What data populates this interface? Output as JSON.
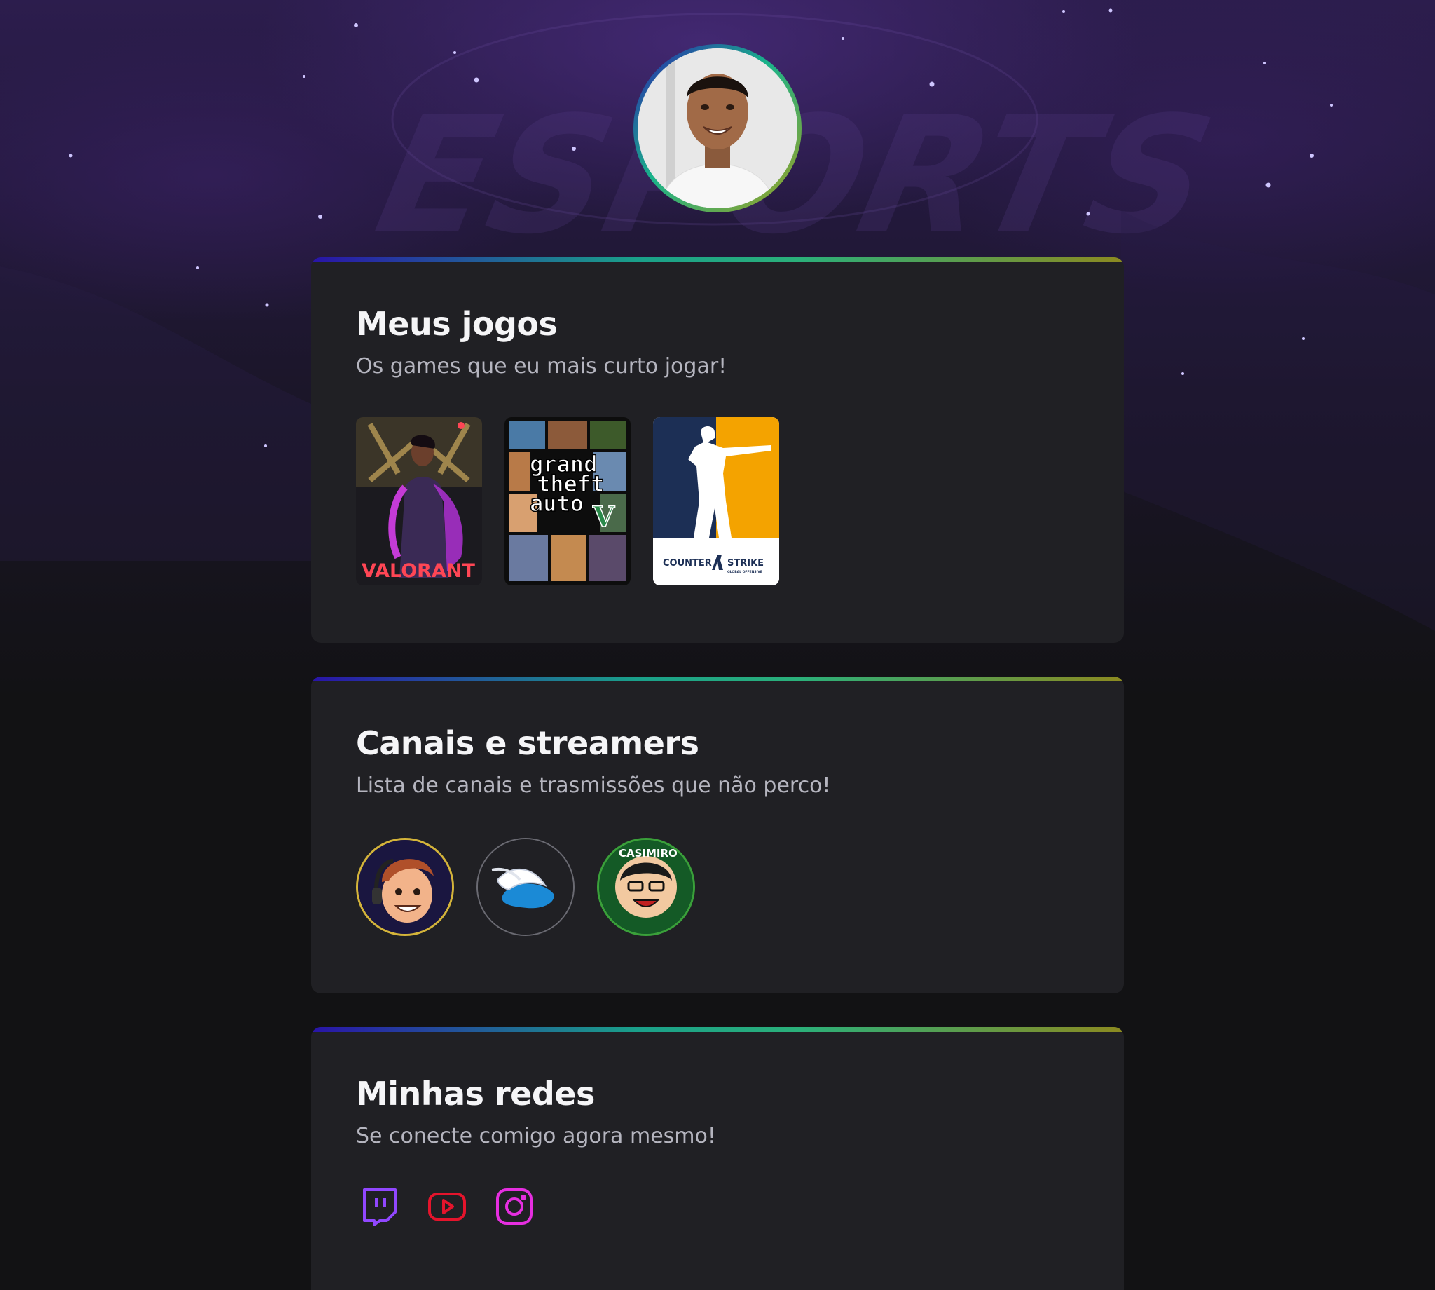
{
  "profile": {
    "avatar_icon": "profile-photo-icon",
    "background_icon": "esports-logo-icon"
  },
  "games_section": {
    "title": "Meus jogos",
    "subtitle": "Os games que eu mais curto jogar!",
    "games": [
      {
        "name": "VALORANT",
        "icon": "valorant-cover-icon"
      },
      {
        "name_lines": [
          "grand",
          "theft",
          "auto"
        ],
        "badge": "V",
        "icon": "gta-v-cover-icon"
      },
      {
        "name_left": "COUNTER",
        "name_right": "STRIKE",
        "sub": "GLOBAL OFFENSIVE",
        "icon": "csgo-cover-icon"
      }
    ]
  },
  "channels_section": {
    "title": "Canais e streamers",
    "subtitle": "Lista de canais e trasmissões que não perco!",
    "channels": [
      {
        "icon": "streamer-cartoon-avatar-icon",
        "ring_color": "#d4b43a"
      },
      {
        "icon": "winged-helmet-avatar-icon",
        "ring_color": "#6a6a72"
      },
      {
        "label": "CASIMIRO",
        "icon": "casimiro-avatar-icon",
        "ring_color": "#3aa03a"
      }
    ]
  },
  "social_section": {
    "title": "Minhas redes",
    "subtitle": "Se conecte comigo agora mesmo!",
    "links": [
      {
        "icon": "twitch-icon",
        "color": "#9147ff"
      },
      {
        "icon": "youtube-icon",
        "color": "#e5142c"
      },
      {
        "icon": "instagram-icon",
        "color": "#e62ee0"
      }
    ]
  }
}
